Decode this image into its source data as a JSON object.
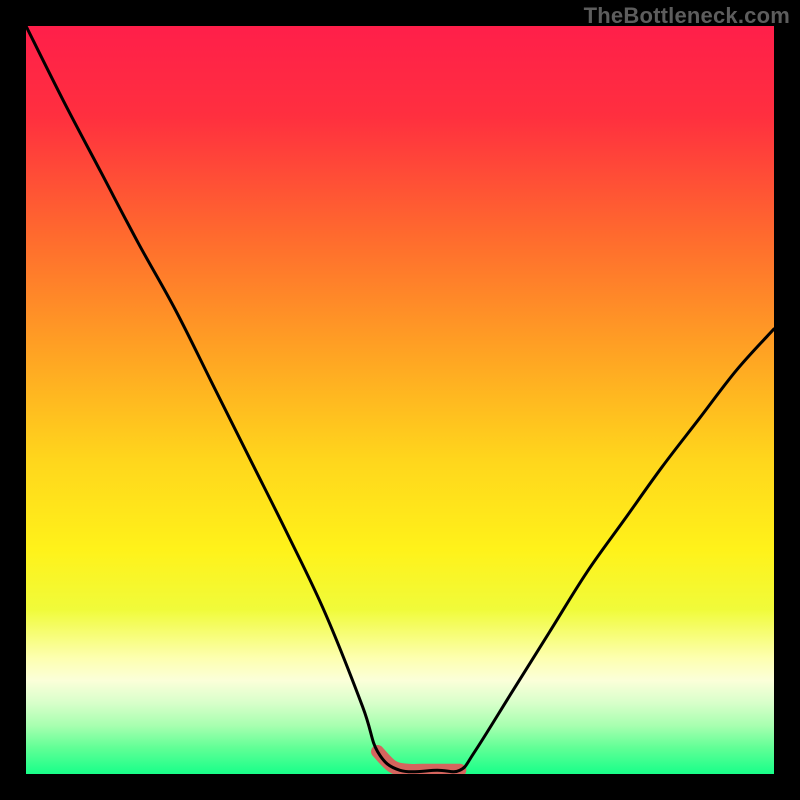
{
  "watermark": "TheBottleneck.com",
  "chart_data": {
    "type": "line",
    "title": "",
    "xlabel": "",
    "ylabel": "",
    "xlim": [
      0,
      100
    ],
    "ylim": [
      0,
      100
    ],
    "series": [
      {
        "name": "bottleneck-curve",
        "x": [
          0,
          5,
          10,
          15,
          20,
          25,
          30,
          35,
          40,
          45,
          47,
          50,
          55,
          58,
          60,
          65,
          70,
          75,
          80,
          85,
          90,
          95,
          100
        ],
        "y": [
          100,
          90,
          80.5,
          71,
          62,
          52,
          42,
          32,
          21.5,
          9,
          3,
          0.5,
          0.5,
          0.5,
          3,
          11,
          19,
          27,
          34,
          41,
          47.5,
          54,
          59.5
        ]
      },
      {
        "name": "highlight-band",
        "x": [
          47,
          49,
          51,
          53,
          55,
          57,
          58
        ],
        "y": [
          3,
          1,
          0.5,
          0.5,
          0.5,
          0.5,
          0.5
        ]
      }
    ],
    "gradient_stops": [
      {
        "pos": 0.0,
        "color": "#ff1f4a"
      },
      {
        "pos": 0.12,
        "color": "#ff2f3f"
      },
      {
        "pos": 0.28,
        "color": "#ff6a2e"
      },
      {
        "pos": 0.44,
        "color": "#ffa423"
      },
      {
        "pos": 0.58,
        "color": "#ffd61c"
      },
      {
        "pos": 0.7,
        "color": "#fff21a"
      },
      {
        "pos": 0.78,
        "color": "#f0fb3a"
      },
      {
        "pos": 0.845,
        "color": "#fdffb0"
      },
      {
        "pos": 0.875,
        "color": "#fbffd9"
      },
      {
        "pos": 0.905,
        "color": "#d8ffca"
      },
      {
        "pos": 0.935,
        "color": "#a8ffb0"
      },
      {
        "pos": 0.965,
        "color": "#61ff96"
      },
      {
        "pos": 1.0,
        "color": "#18ff89"
      }
    ],
    "colors": {
      "curve": "#000000",
      "highlight": "#d5655e",
      "frame_bg": "#000000"
    }
  }
}
